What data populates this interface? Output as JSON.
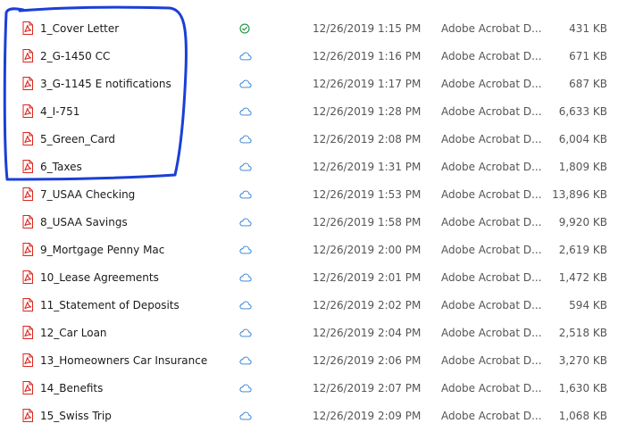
{
  "colors": {
    "pdf_icon": "#d9251c",
    "synced": "#1a8f3c",
    "cloud": "#2b7cd3",
    "annotation": "#1b3fd6"
  },
  "files": [
    {
      "name": "1_Cover Letter",
      "modified": "12/26/2019 1:15 PM",
      "type": "Adobe Acrobat D...",
      "size": "431 KB",
      "status_icon": "synced-check-icon"
    },
    {
      "name": "2_G-1450 CC",
      "modified": "12/26/2019 1:16 PM",
      "type": "Adobe Acrobat D...",
      "size": "671 KB",
      "status_icon": "cloud-icon"
    },
    {
      "name": "3_G-1145 E notifications",
      "modified": "12/26/2019 1:17 PM",
      "type": "Adobe Acrobat D...",
      "size": "687 KB",
      "status_icon": "cloud-icon"
    },
    {
      "name": "4_I-751",
      "modified": "12/26/2019 1:28 PM",
      "type": "Adobe Acrobat D...",
      "size": "6,633 KB",
      "status_icon": "cloud-icon"
    },
    {
      "name": "5_Green_Card",
      "modified": "12/26/2019 2:08 PM",
      "type": "Adobe Acrobat D...",
      "size": "6,004 KB",
      "status_icon": "cloud-icon"
    },
    {
      "name": "6_Taxes",
      "modified": "12/26/2019 1:31 PM",
      "type": "Adobe Acrobat D...",
      "size": "1,809 KB",
      "status_icon": "cloud-icon"
    },
    {
      "name": "7_USAA Checking",
      "modified": "12/26/2019 1:53 PM",
      "type": "Adobe Acrobat D...",
      "size": "13,896 KB",
      "status_icon": "cloud-icon"
    },
    {
      "name": "8_USAA Savings",
      "modified": "12/26/2019 1:58 PM",
      "type": "Adobe Acrobat D...",
      "size": "9,920 KB",
      "status_icon": "cloud-icon"
    },
    {
      "name": "9_Mortgage Penny Mac",
      "modified": "12/26/2019 2:00 PM",
      "type": "Adobe Acrobat D...",
      "size": "2,619 KB",
      "status_icon": "cloud-icon"
    },
    {
      "name": "10_Lease Agreements",
      "modified": "12/26/2019 2:01 PM",
      "type": "Adobe Acrobat D...",
      "size": "1,472 KB",
      "status_icon": "cloud-icon"
    },
    {
      "name": "11_Statement of Deposits",
      "modified": "12/26/2019 2:02 PM",
      "type": "Adobe Acrobat D...",
      "size": "594 KB",
      "status_icon": "cloud-icon"
    },
    {
      "name": "12_Car Loan",
      "modified": "12/26/2019 2:04 PM",
      "type": "Adobe Acrobat D...",
      "size": "2,518 KB",
      "status_icon": "cloud-icon"
    },
    {
      "name": "13_Homeowners Car Insurance",
      "modified": "12/26/2019 2:06 PM",
      "type": "Adobe Acrobat D...",
      "size": "3,270 KB",
      "status_icon": "cloud-icon"
    },
    {
      "name": "14_Benefits",
      "modified": "12/26/2019 2:07 PM",
      "type": "Adobe Acrobat D...",
      "size": "1,630 KB",
      "status_icon": "cloud-icon"
    },
    {
      "name": "15_Swiss Trip",
      "modified": "12/26/2019 2:09 PM",
      "type": "Adobe Acrobat D...",
      "size": "1,068 KB",
      "status_icon": "cloud-icon"
    }
  ]
}
